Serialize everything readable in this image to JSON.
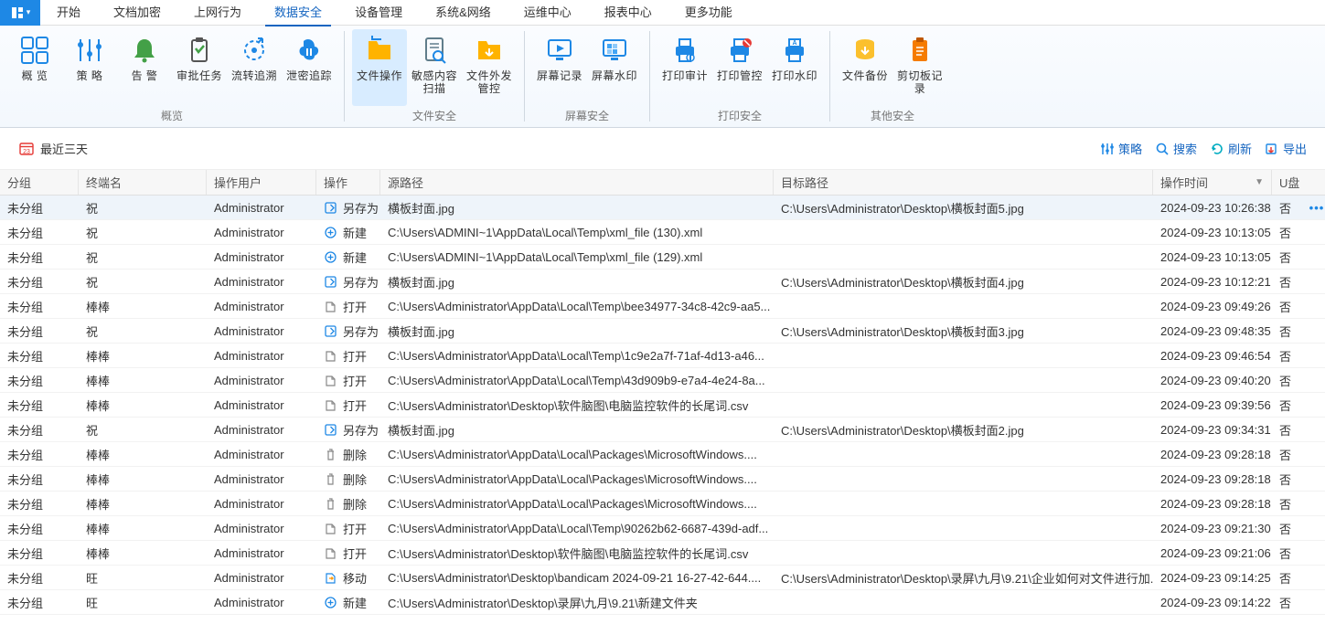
{
  "menubar": {
    "items": [
      {
        "label": "开始",
        "active": false
      },
      {
        "label": "文档加密",
        "active": false
      },
      {
        "label": "上网行为",
        "active": false
      },
      {
        "label": "数据安全",
        "active": true
      },
      {
        "label": "设备管理",
        "active": false
      },
      {
        "label": "系统&网络",
        "active": false
      },
      {
        "label": "运维中心",
        "active": false
      },
      {
        "label": "报表中心",
        "active": false
      },
      {
        "label": "更多功能",
        "active": false
      }
    ]
  },
  "ribbon": {
    "groups": [
      {
        "label": "概览",
        "buttons": [
          {
            "label": "概 览",
            "icon": "overview",
            "color": "#1e88e5"
          },
          {
            "label": "策 略",
            "icon": "sliders",
            "color": "#1e88e5"
          },
          {
            "label": "告 警",
            "icon": "bell",
            "color": "#43a047"
          },
          {
            "label": "审批任务",
            "icon": "clipboard",
            "color": "#555"
          },
          {
            "label": "流转追溯",
            "icon": "trace",
            "color": "#1e88e5"
          },
          {
            "label": "泄密追踪",
            "icon": "leak",
            "color": "#1e88e5"
          }
        ]
      },
      {
        "label": "文件安全",
        "buttons": [
          {
            "label": "文件操作",
            "icon": "folder-arrow",
            "color": "#ffb300",
            "active": true
          },
          {
            "label": "敏感内容扫描",
            "icon": "scan",
            "color": "#607d8b"
          },
          {
            "label": "文件外发管控",
            "icon": "folder-out",
            "color": "#ffb300"
          }
        ]
      },
      {
        "label": "屏幕安全",
        "buttons": [
          {
            "label": "屏幕记录",
            "icon": "screen-rec",
            "color": "#1e88e5"
          },
          {
            "label": "屏幕水印",
            "icon": "watermark",
            "color": "#1e88e5"
          }
        ]
      },
      {
        "label": "打印安全",
        "buttons": [
          {
            "label": "打印审计",
            "icon": "print-audit",
            "color": "#1e88e5"
          },
          {
            "label": "打印管控",
            "icon": "print-ctrl",
            "color": "#1e88e5"
          },
          {
            "label": "打印水印",
            "icon": "print-wm",
            "color": "#1e88e5"
          }
        ]
      },
      {
        "label": "其他安全",
        "buttons": [
          {
            "label": "文件备份",
            "icon": "backup",
            "color": "#fbc02d"
          },
          {
            "label": "剪切板记录",
            "icon": "clipboard-rec",
            "color": "#f57c00"
          }
        ]
      }
    ]
  },
  "toolbar": {
    "date_filter": "最近三天",
    "actions": [
      {
        "label": "策略",
        "icon": "sliders"
      },
      {
        "label": "搜索",
        "icon": "search"
      },
      {
        "label": "刷新",
        "icon": "refresh"
      },
      {
        "label": "导出",
        "icon": "export"
      }
    ]
  },
  "table": {
    "headers": {
      "group": "分组",
      "term": "终端名",
      "user": "操作用户",
      "op": "操作",
      "src": "源路径",
      "dst": "目标路径",
      "time": "操作时间",
      "usb": "U盘"
    },
    "rows": [
      {
        "group": "未分组",
        "term": "祝",
        "user": "Administrator",
        "op": "另存为",
        "op_icon": "saveas",
        "src": "横板封面.jpg",
        "dst": "C:\\Users\\Administrator\\Desktop\\横板封面5.jpg",
        "time": "2024-09-23 10:26:38",
        "usb": "否",
        "sel": true
      },
      {
        "group": "未分组",
        "term": "祝",
        "user": "Administrator",
        "op": "新建",
        "op_icon": "new",
        "src": "C:\\Users\\ADMINI~1\\AppData\\Local\\Temp\\xml_file (130).xml",
        "dst": "",
        "time": "2024-09-23 10:13:05",
        "usb": "否"
      },
      {
        "group": "未分组",
        "term": "祝",
        "user": "Administrator",
        "op": "新建",
        "op_icon": "new",
        "src": "C:\\Users\\ADMINI~1\\AppData\\Local\\Temp\\xml_file (129).xml",
        "dst": "",
        "time": "2024-09-23 10:13:05",
        "usb": "否"
      },
      {
        "group": "未分组",
        "term": "祝",
        "user": "Administrator",
        "op": "另存为",
        "op_icon": "saveas",
        "src": "横板封面.jpg",
        "dst": "C:\\Users\\Administrator\\Desktop\\横板封面4.jpg",
        "time": "2024-09-23 10:12:21",
        "usb": "否"
      },
      {
        "group": "未分组",
        "term": "棒棒",
        "user": "Administrator",
        "op": "打开",
        "op_icon": "open",
        "src": "C:\\Users\\Administrator\\AppData\\Local\\Temp\\bee34977-34c8-42c9-aa5...",
        "dst": "",
        "time": "2024-09-23 09:49:26",
        "usb": "否"
      },
      {
        "group": "未分组",
        "term": "祝",
        "user": "Administrator",
        "op": "另存为",
        "op_icon": "saveas",
        "src": "横板封面.jpg",
        "dst": "C:\\Users\\Administrator\\Desktop\\横板封面3.jpg",
        "time": "2024-09-23 09:48:35",
        "usb": "否"
      },
      {
        "group": "未分组",
        "term": "棒棒",
        "user": "Administrator",
        "op": "打开",
        "op_icon": "open",
        "src": "C:\\Users\\Administrator\\AppData\\Local\\Temp\\1c9e2a7f-71af-4d13-a46...",
        "dst": "",
        "time": "2024-09-23 09:46:54",
        "usb": "否"
      },
      {
        "group": "未分组",
        "term": "棒棒",
        "user": "Administrator",
        "op": "打开",
        "op_icon": "open",
        "src": "C:\\Users\\Administrator\\AppData\\Local\\Temp\\43d909b9-e7a4-4e24-8a...",
        "dst": "",
        "time": "2024-09-23 09:40:20",
        "usb": "否"
      },
      {
        "group": "未分组",
        "term": "棒棒",
        "user": "Administrator",
        "op": "打开",
        "op_icon": "open",
        "src": "C:\\Users\\Administrator\\Desktop\\软件脑图\\电脑监控软件的长尾词.csv",
        "dst": "",
        "time": "2024-09-23 09:39:56",
        "usb": "否"
      },
      {
        "group": "未分组",
        "term": "祝",
        "user": "Administrator",
        "op": "另存为",
        "op_icon": "saveas",
        "src": "横板封面.jpg",
        "dst": "C:\\Users\\Administrator\\Desktop\\横板封面2.jpg",
        "time": "2024-09-23 09:34:31",
        "usb": "否"
      },
      {
        "group": "未分组",
        "term": "棒棒",
        "user": "Administrator",
        "op": "删除",
        "op_icon": "delete",
        "src": "C:\\Users\\Administrator\\AppData\\Local\\Packages\\MicrosoftWindows....",
        "dst": "",
        "time": "2024-09-23 09:28:18",
        "usb": "否"
      },
      {
        "group": "未分组",
        "term": "棒棒",
        "user": "Administrator",
        "op": "删除",
        "op_icon": "delete",
        "src": "C:\\Users\\Administrator\\AppData\\Local\\Packages\\MicrosoftWindows....",
        "dst": "",
        "time": "2024-09-23 09:28:18",
        "usb": "否"
      },
      {
        "group": "未分组",
        "term": "棒棒",
        "user": "Administrator",
        "op": "删除",
        "op_icon": "delete",
        "src": "C:\\Users\\Administrator\\AppData\\Local\\Packages\\MicrosoftWindows....",
        "dst": "",
        "time": "2024-09-23 09:28:18",
        "usb": "否"
      },
      {
        "group": "未分组",
        "term": "棒棒",
        "user": "Administrator",
        "op": "打开",
        "op_icon": "open",
        "src": "C:\\Users\\Administrator\\AppData\\Local\\Temp\\90262b62-6687-439d-adf...",
        "dst": "",
        "time": "2024-09-23 09:21:30",
        "usb": "否"
      },
      {
        "group": "未分组",
        "term": "棒棒",
        "user": "Administrator",
        "op": "打开",
        "op_icon": "open",
        "src": "C:\\Users\\Administrator\\Desktop\\软件脑图\\电脑监控软件的长尾词.csv",
        "dst": "",
        "time": "2024-09-23 09:21:06",
        "usb": "否"
      },
      {
        "group": "未分组",
        "term": "旺",
        "user": "Administrator",
        "op": "移动",
        "op_icon": "move",
        "src": "C:\\Users\\Administrator\\Desktop\\bandicam 2024-09-21 16-27-42-644....",
        "dst": "C:\\Users\\Administrator\\Desktop\\录屏\\九月\\9.21\\企业如何对文件进行加...",
        "time": "2024-09-23 09:14:25",
        "usb": "否"
      },
      {
        "group": "未分组",
        "term": "旺",
        "user": "Administrator",
        "op": "新建",
        "op_icon": "new",
        "src": "C:\\Users\\Administrator\\Desktop\\录屏\\九月\\9.21\\新建文件夹",
        "dst": "",
        "time": "2024-09-23 09:14:22",
        "usb": "否"
      }
    ]
  }
}
